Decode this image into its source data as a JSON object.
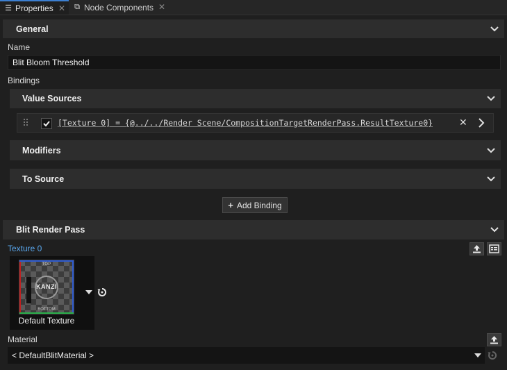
{
  "tabs": [
    {
      "label": "Properties",
      "icon": "list-icon"
    },
    {
      "label": "Node Components",
      "icon": "components-icon"
    }
  ],
  "general": {
    "title": "General",
    "name_label": "Name",
    "name_value": "Blit Bloom Threshold",
    "bindings_label": "Bindings"
  },
  "bindings": {
    "value_sources_title": "Value Sources",
    "rows": [
      {
        "expression": "[Texture 0] = {@../../Render Scene/CompositionTargetRenderPass.ResultTexture0}",
        "checked": true
      }
    ],
    "modifiers_title": "Modifiers",
    "to_source_title": "To Source",
    "add_binding_label": "Add Binding"
  },
  "blit_render_pass": {
    "title": "Blit Render Pass",
    "texture_label": "Texture 0",
    "texture_caption": "Default Texture",
    "thumb_logo": "KANZI",
    "thumb_top": "TOP",
    "thumb_bottom": "BOTTOM",
    "material_label": "Material",
    "material_value": "< DefaultBlitMaterial >"
  },
  "colors": {
    "accent": "#3c7fd1",
    "link_label": "#5aa8ef",
    "background": "#1f1f1f",
    "section": "#2d2d2d"
  }
}
